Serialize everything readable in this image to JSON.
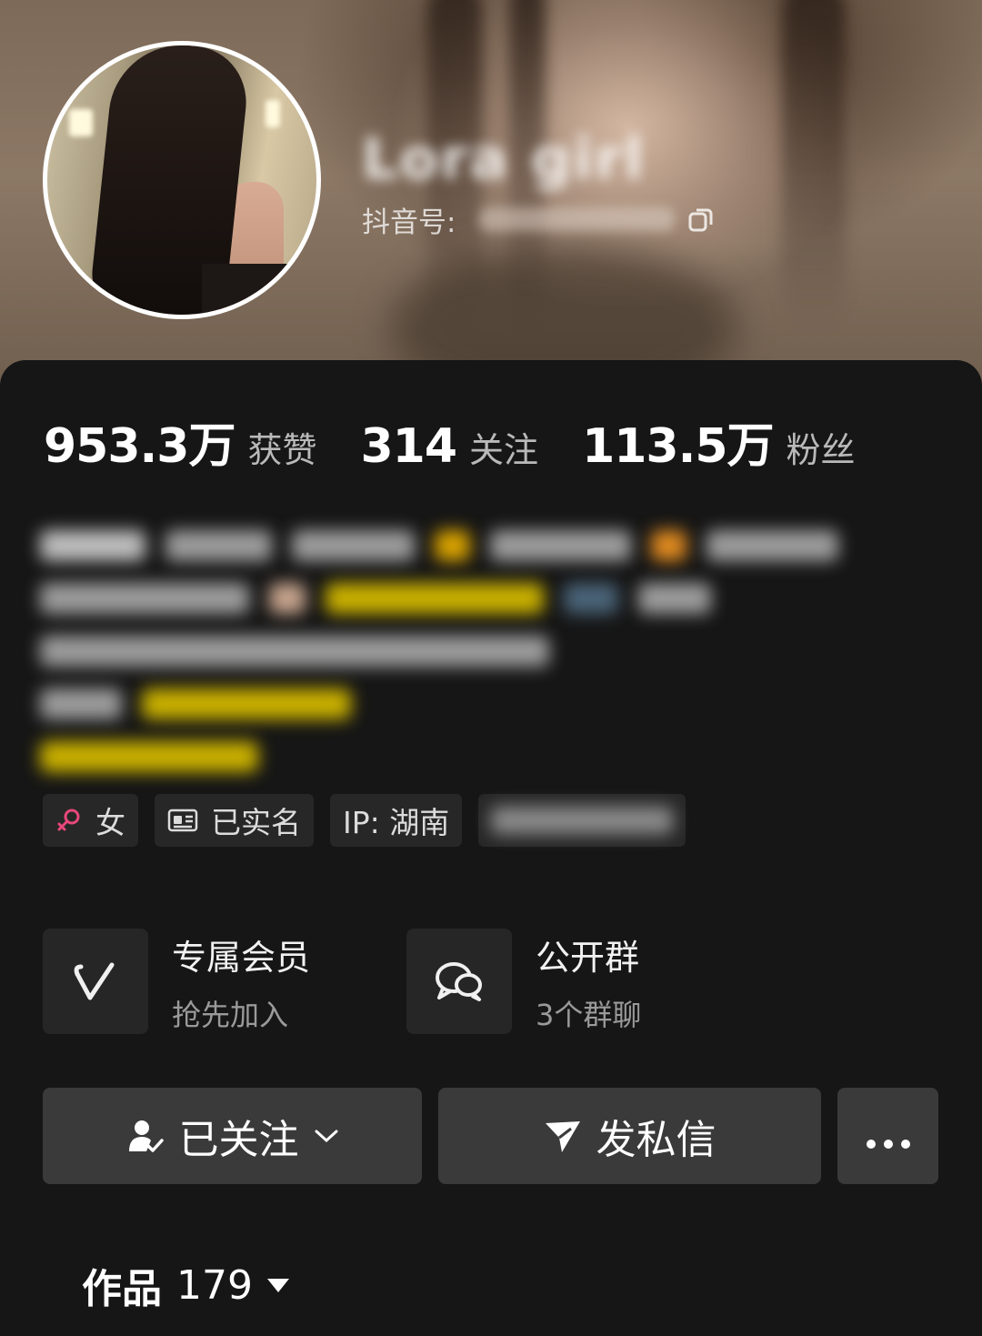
{
  "profile": {
    "nickname": "Lora girl",
    "account_label": "抖音号:"
  },
  "stats": [
    {
      "value": "953.3万",
      "label": "获赞"
    },
    {
      "value": "314",
      "label": "关注"
    },
    {
      "value": "113.5万",
      "label": "粉丝"
    }
  ],
  "tags": {
    "gender": "女",
    "verified": "已实名",
    "ip": "IP:  湖南"
  },
  "features": {
    "membership": {
      "title": "专属会员",
      "subtitle": "抢先加入"
    },
    "group": {
      "title": "公开群",
      "subtitle": "3个群聊"
    }
  },
  "actions": {
    "follow_label": "已关注",
    "message_label": "发私信"
  },
  "works_tab": {
    "label": "作品",
    "count": "179"
  },
  "colors": {
    "background": "#161616",
    "card": "#262626",
    "button": "#3a3a3a",
    "female_icon": "#e8487b",
    "bio_highlight": "#d9b800"
  },
  "icons": [
    "copy-icon",
    "female-icon",
    "id-card-icon",
    "vip-v-icon",
    "group-chat-icon",
    "follow-user-icon",
    "chevron-down-icon",
    "send-icon",
    "more-icon",
    "caret-down-icon"
  ]
}
